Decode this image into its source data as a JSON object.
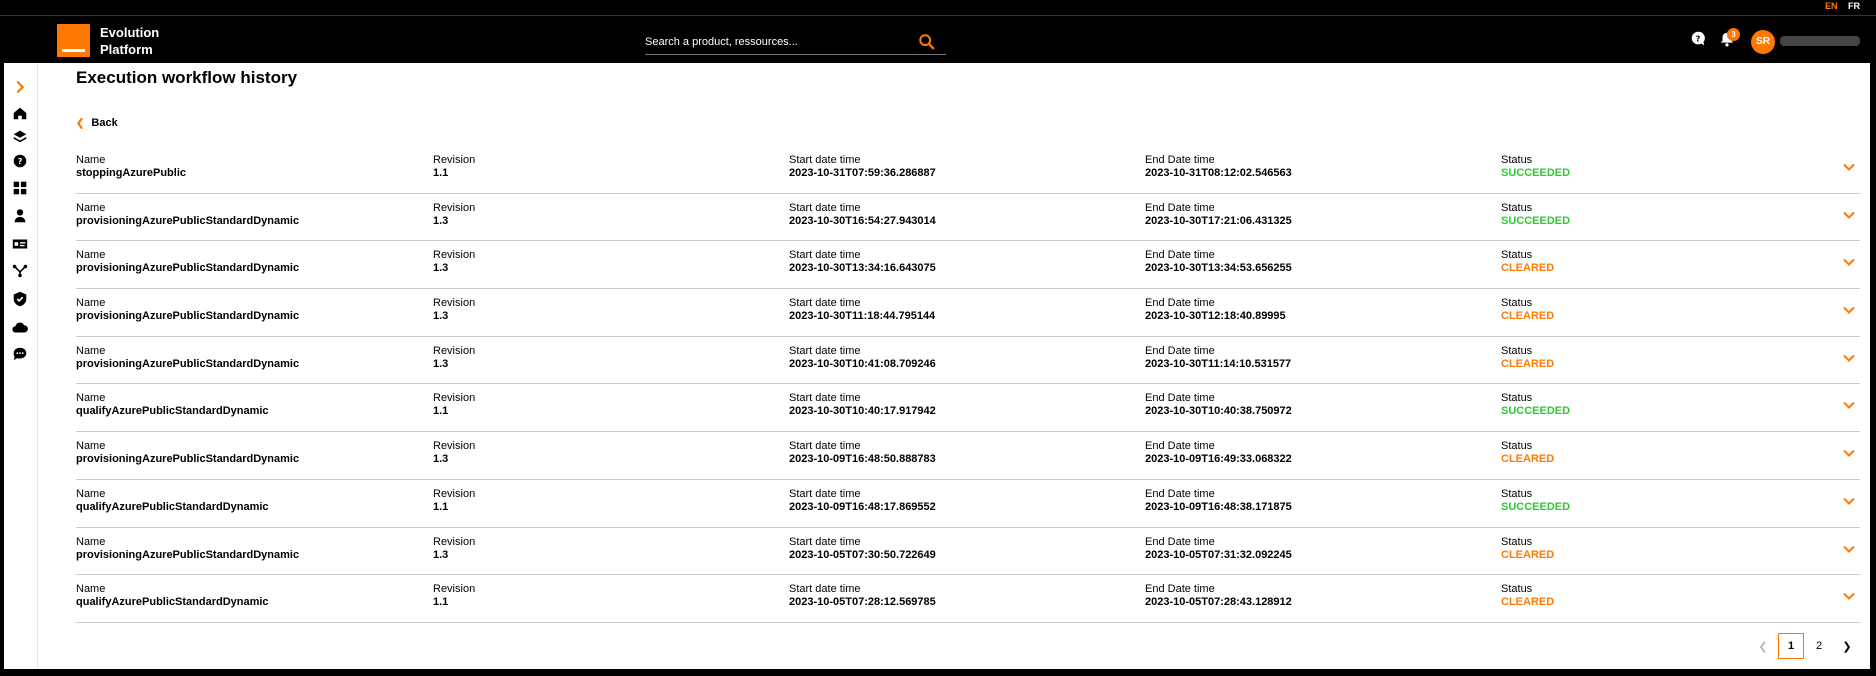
{
  "header": {
    "brand_line1": "Evolution",
    "brand_line2": "Platform",
    "search_placeholder": "Search a product, ressources...",
    "lang_en": "EN",
    "lang_fr": "FR",
    "notification_count": "3",
    "avatar_initials": "SR",
    "accent_color": "#ff7900"
  },
  "page": {
    "title": "Execution workflow history",
    "back_label": "Back"
  },
  "labels": {
    "name": "Name",
    "revision": "Revision",
    "start": "Start date time",
    "end": "End Date time",
    "status": "Status"
  },
  "rows": [
    {
      "name": "stoppingAzurePublic",
      "revision": "1.1",
      "start": "2023-10-31T07:59:36.286887",
      "end": "2023-10-31T08:12:02.546563",
      "status": "SUCCEEDED"
    },
    {
      "name": "provisioningAzurePublicStandardDynamic",
      "revision": "1.3",
      "start": "2023-10-30T16:54:27.943014",
      "end": "2023-10-30T17:21:06.431325",
      "status": "SUCCEEDED"
    },
    {
      "name": "provisioningAzurePublicStandardDynamic",
      "revision": "1.3",
      "start": "2023-10-30T13:34:16.643075",
      "end": "2023-10-30T13:34:53.656255",
      "status": "CLEARED"
    },
    {
      "name": "provisioningAzurePublicStandardDynamic",
      "revision": "1.3",
      "start": "2023-10-30T11:18:44.795144",
      "end": "2023-10-30T12:18:40.89995",
      "status": "CLEARED"
    },
    {
      "name": "provisioningAzurePublicStandardDynamic",
      "revision": "1.3",
      "start": "2023-10-30T10:41:08.709246",
      "end": "2023-10-30T11:14:10.531577",
      "status": "CLEARED"
    },
    {
      "name": "qualifyAzurePublicStandardDynamic",
      "revision": "1.1",
      "start": "2023-10-30T10:40:17.917942",
      "end": "2023-10-30T10:40:38.750972",
      "status": "SUCCEEDED"
    },
    {
      "name": "provisioningAzurePublicStandardDynamic",
      "revision": "1.3",
      "start": "2023-10-09T16:48:50.888783",
      "end": "2023-10-09T16:49:33.068322",
      "status": "CLEARED"
    },
    {
      "name": "qualifyAzurePublicStandardDynamic",
      "revision": "1.1",
      "start": "2023-10-09T16:48:17.869552",
      "end": "2023-10-09T16:48:38.171875",
      "status": "SUCCEEDED"
    },
    {
      "name": "provisioningAzurePublicStandardDynamic",
      "revision": "1.3",
      "start": "2023-10-05T07:30:50.722649",
      "end": "2023-10-05T07:31:32.092245",
      "status": "CLEARED"
    },
    {
      "name": "qualifyAzurePublicStandardDynamic",
      "revision": "1.1",
      "start": "2023-10-05T07:28:12.569785",
      "end": "2023-10-05T07:28:43.128912",
      "status": "CLEARED"
    }
  ],
  "status_colors": {
    "SUCCEEDED": "#32c832",
    "CLEARED": "#ff7900"
  },
  "pagination": {
    "pages": [
      "1",
      "2"
    ],
    "current": "1"
  },
  "sidebar_icons": [
    "chevron-right-icon",
    "home-icon",
    "catalog-icon",
    "help-icon",
    "dashboard-icon",
    "user-icon",
    "id-card-icon",
    "network-icon",
    "shield-icon",
    "cloud-icon",
    "chat-icon"
  ]
}
